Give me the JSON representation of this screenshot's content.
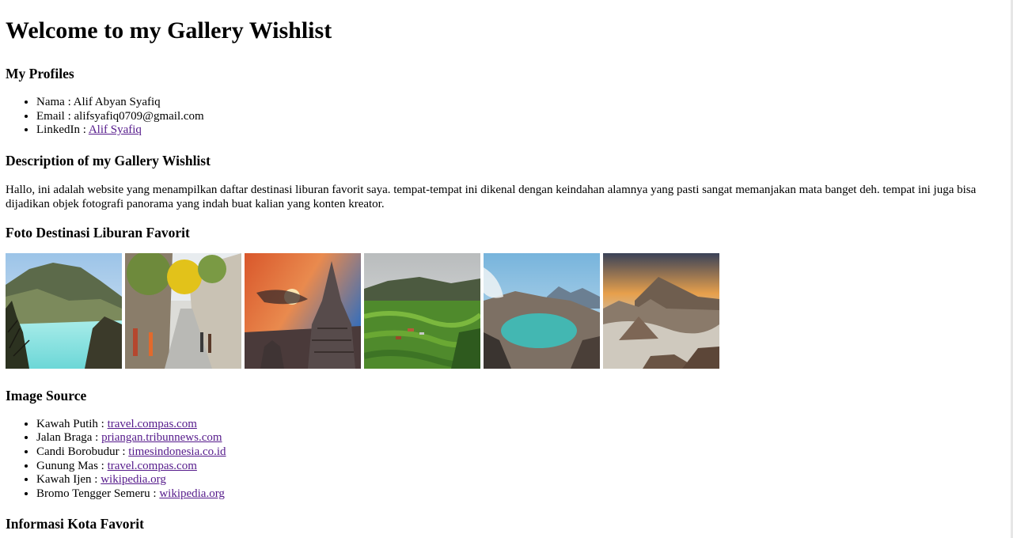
{
  "page_title": "Welcome to my Gallery Wishlist",
  "profile": {
    "heading": "My Profiles",
    "name_label": "Nama : ",
    "name_value": "Alif Abyan Syafiq",
    "email_label": "Email : ",
    "email_value": "alifsyafiq0709@gmail.com",
    "linkedin_label": "LinkedIn : ",
    "linkedin_link": "Alif Syafiq"
  },
  "description": {
    "heading": "Description of my Gallery Wishlist",
    "text": "Hallo, ini adalah website yang menampilkan daftar destinasi liburan favorit saya. tempat-tempat ini dikenal dengan keindahan alamnya yang pasti sangat memanjakan mata banget deh. tempat ini juga bisa dijadikan objek fotografi panorama yang indah buat kalian yang konten kreator."
  },
  "photos": {
    "heading": "Foto Destinasi Liburan Favorit"
  },
  "sources": {
    "heading": "Image Source",
    "items": [
      {
        "label": "Kawah Putih : ",
        "link": "travel.compas.com"
      },
      {
        "label": "Jalan Braga : ",
        "link": "priangan.tribunnews.com"
      },
      {
        "label": "Candi Borobudur : ",
        "link": "timesindonesia.co.id"
      },
      {
        "label": "Gunung Mas : ",
        "link": "travel.compas.com"
      },
      {
        "label": "Kawah Ijen : ",
        "link": "wikipedia.org"
      },
      {
        "label": "Bromo Tengger Semeru : ",
        "link": "wikipedia.org"
      }
    ]
  },
  "city": {
    "heading": "Informasi Kota Favorit"
  },
  "colors": {
    "link_visited": "#551a8b",
    "text": "#000000",
    "background": "#ffffff"
  }
}
